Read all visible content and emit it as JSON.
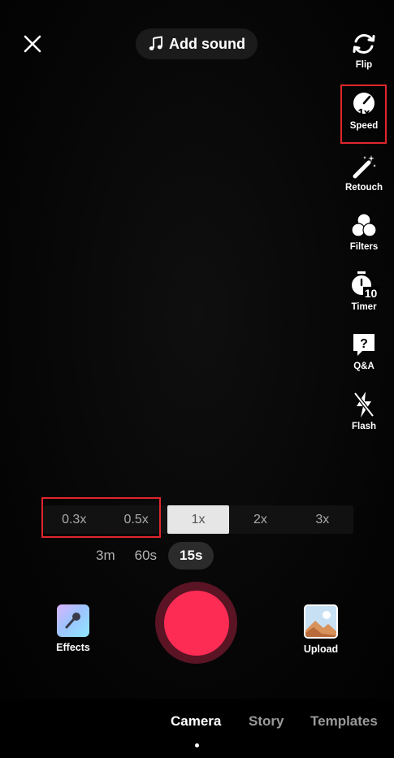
{
  "top_bar": {
    "close_icon": "close-icon",
    "add_sound_label": "Add sound",
    "add_sound_icon": "music-note-icon"
  },
  "toolbar": {
    "flip": "Flip",
    "speed": "Speed",
    "speed_value": "1x",
    "retouch": "Retouch",
    "filters": "Filters",
    "timer": "Timer",
    "timer_value": "10",
    "qa": "Q&A",
    "flash": "Flash"
  },
  "speed_options": [
    "0.3x",
    "0.5x",
    "1x",
    "2x",
    "3x"
  ],
  "speed_selected": "1x",
  "durations": [
    "3m",
    "60s",
    "15s"
  ],
  "duration_selected": "15s",
  "controls": {
    "effects": "Effects",
    "upload": "Upload"
  },
  "nav": {
    "camera": "Camera",
    "story": "Story",
    "templates": "Templates"
  },
  "colors": {
    "record": "#fd2c55",
    "record_ring": "#5a1424",
    "highlight": "#e0262c"
  }
}
